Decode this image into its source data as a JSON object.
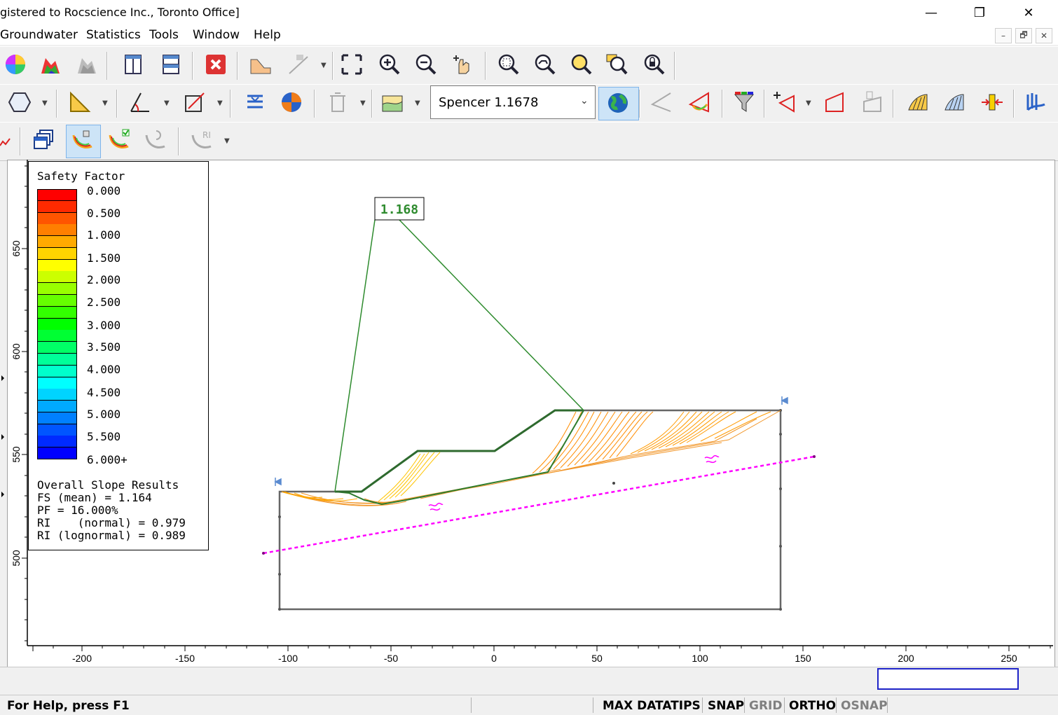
{
  "window": {
    "title": "gistered to Rocscience Inc., Toronto Office]",
    "controls": {
      "minimize": "—",
      "restore": "❐",
      "close": "✕"
    }
  },
  "menu": {
    "items": [
      "Groundwater",
      "Statistics",
      "Tools",
      "Window",
      "Help"
    ],
    "mdi_controls": {
      "minimize": "–",
      "restore": "🗗",
      "close": "✕"
    }
  },
  "toolbar": {
    "method_combo": {
      "value": "Spencer 1.1678"
    }
  },
  "legend": {
    "title": "Safety Factor",
    "labels": [
      "0.000",
      "0.500",
      "1.000",
      "1.500",
      "2.000",
      "2.500",
      "3.000",
      "3.500",
      "4.000",
      "4.500",
      "5.000",
      "5.500",
      "6.000+"
    ],
    "colors": [
      "#ff0000",
      "#ff2a00",
      "#ff5500",
      "#ff7f00",
      "#ffaa00",
      "#ffd400",
      "#ffff00",
      "#ccff00",
      "#99ff00",
      "#66ff00",
      "#33ff00",
      "#00ff00",
      "#00ff33",
      "#00ff66",
      "#00ff99",
      "#00ffcc",
      "#00ffff",
      "#00d4ff",
      "#00aaff",
      "#0080ff",
      "#0055ff",
      "#002aff",
      "#0000ff"
    ],
    "results_title": "Overall Slope Results",
    "results": [
      "FS (mean) = 1.164",
      "PF = 16.000%",
      "RI    (normal) = 0.979",
      "RI (lognormal) = 0.989"
    ]
  },
  "model": {
    "min_fs_label": "1.168",
    "x_ticks": [
      "-200",
      "-150",
      "-100",
      "-50",
      "0",
      "50",
      "100",
      "150",
      "200",
      "250"
    ],
    "y_ticks": [
      "650",
      "600",
      "550",
      "500"
    ]
  },
  "status": {
    "help": "For Help, press F1",
    "max_datatips": "MAX DATATIPS",
    "snap": "SNAP",
    "grid": "GRID",
    "ortho": "ORTHO",
    "osnap": "OSNAP"
  }
}
